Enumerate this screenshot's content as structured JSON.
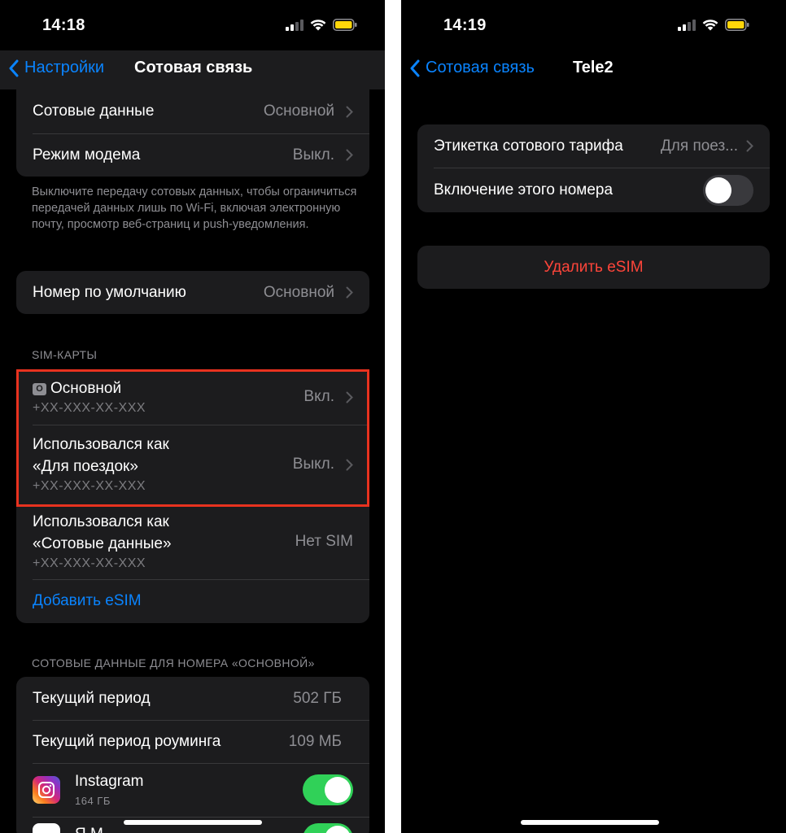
{
  "left": {
    "status": {
      "time": "14:18"
    },
    "nav": {
      "back_label": "Настройки",
      "title": "Сотовая связь"
    },
    "group1": {
      "cellular_data_label": "Сотовые данные",
      "cellular_data_value": "Основной",
      "hotspot_label": "Режим модема",
      "hotspot_value": "Выкл."
    },
    "footnote": "Выключите передачу сотовых данных, чтобы ограничиться передачей данных лишь по Wi-Fi, включая электронную почту, просмотр веб-страниц и push-уведомления.",
    "default_number": {
      "label": "Номер по умолчанию",
      "value": "Основной"
    },
    "sim_header": "SIM-КАРТЫ",
    "sims": [
      {
        "badge": "O",
        "title": "Основной",
        "number": "+XX-XXX-XX-XXX",
        "status": "Вкл."
      },
      {
        "title_line1": "Использовался как",
        "title_line2": "«Для поездок»",
        "number": "+XX-XXX-XX-XXX",
        "status": "Выкл."
      },
      {
        "title_line1": "Использовался как",
        "title_line2": "«Сотовые данные»",
        "number": "+XX-XXX-XX-XXX",
        "status": "Нет SIM"
      }
    ],
    "add_esim": "Добавить eSIM",
    "data_header": "СОТОВЫЕ ДАННЫЕ ДЛЯ НОМЕРА «ОСНОВНОЙ»",
    "usage": {
      "current_period_label": "Текущий период",
      "current_period_value": "502 ГБ",
      "roaming_label": "Текущий период роуминга",
      "roaming_value": "109 МБ"
    },
    "apps": [
      {
        "name": "Instagram",
        "size": "164 ГБ",
        "enabled": true
      },
      {
        "name": "Я.М",
        "enabled": true
      }
    ]
  },
  "right": {
    "status": {
      "time": "14:19"
    },
    "nav": {
      "back_label": "Сотовая связь",
      "title": "Tele2"
    },
    "plan_label": {
      "label": "Этикетка сотового тарифа",
      "value": "Для поез..."
    },
    "turn_on": {
      "label": "Включение этого номера",
      "enabled": false
    },
    "delete_esim": "Удалить eSIM"
  },
  "colors": {
    "accent_blue": "#0a84ff",
    "destructive_red": "#ff453a",
    "toggle_green": "#30d158",
    "highlight_red": "#e8321f"
  }
}
